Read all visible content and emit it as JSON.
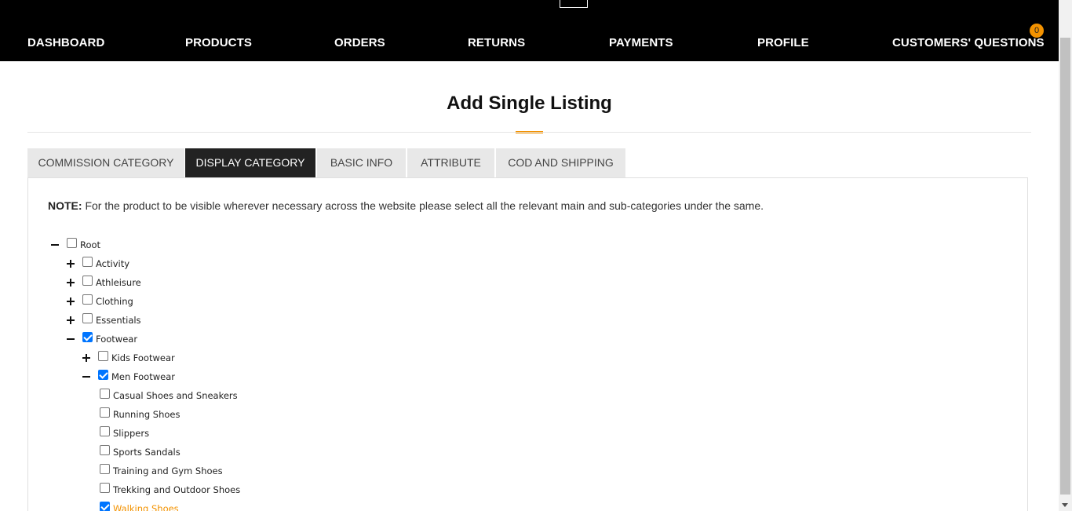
{
  "nav": {
    "items": [
      {
        "label": "DASHBOARD"
      },
      {
        "label": "PRODUCTS"
      },
      {
        "label": "ORDERS"
      },
      {
        "label": "RETURNS"
      },
      {
        "label": "PAYMENTS"
      },
      {
        "label": "PROFILE"
      },
      {
        "label": "CUSTOMERS' QUESTIONS"
      }
    ],
    "questions_badge": "0"
  },
  "page": {
    "title": "Add Single Listing"
  },
  "tabs": [
    {
      "label": "COMMISSION CATEGORY",
      "active": false
    },
    {
      "label": "DISPLAY CATEGORY",
      "active": true
    },
    {
      "label": "BASIC INFO",
      "active": false
    },
    {
      "label": "ATTRIBUTE",
      "active": false
    },
    {
      "label": "COD AND SHIPPING",
      "active": false
    }
  ],
  "note": {
    "prefix": "NOTE:",
    "text": " For the product to be visible wherever necessary across the website please select all the relevant main and sub-categories under the same."
  },
  "tree": [
    {
      "label": "Root",
      "level": 0,
      "toggle": "minus",
      "checked": false
    },
    {
      "label": "Activity",
      "level": 1,
      "toggle": "plus",
      "checked": false
    },
    {
      "label": "Athleisure",
      "level": 1,
      "toggle": "plus",
      "checked": false
    },
    {
      "label": "Clothing",
      "level": 1,
      "toggle": "plus",
      "checked": false
    },
    {
      "label": "Essentials",
      "level": 1,
      "toggle": "plus",
      "checked": false
    },
    {
      "label": "Footwear",
      "level": 1,
      "toggle": "minus",
      "checked": true
    },
    {
      "label": "Kids Footwear",
      "level": 2,
      "toggle": "plus",
      "checked": false
    },
    {
      "label": "Men Footwear",
      "level": 2,
      "toggle": "minus",
      "checked": true
    },
    {
      "label": "Casual Shoes and Sneakers",
      "level": 3,
      "toggle": "none",
      "checked": false
    },
    {
      "label": "Running Shoes",
      "level": 3,
      "toggle": "none",
      "checked": false
    },
    {
      "label": "Slippers",
      "level": 3,
      "toggle": "none",
      "checked": false
    },
    {
      "label": "Sports Sandals",
      "level": 3,
      "toggle": "none",
      "checked": false
    },
    {
      "label": "Training and Gym Shoes",
      "level": 3,
      "toggle": "none",
      "checked": false
    },
    {
      "label": "Trekking and Outdoor Shoes",
      "level": 3,
      "toggle": "none",
      "checked": false
    },
    {
      "label": "Walking Shoes",
      "level": 3,
      "toggle": "none",
      "checked": true,
      "highlight": true
    }
  ],
  "colors": {
    "accent": "#f39200",
    "nav_bg": "#000000",
    "tab_active_bg": "#222222",
    "tab_bg": "#e8e8e8",
    "checkbox_checked": "#0075ff"
  }
}
